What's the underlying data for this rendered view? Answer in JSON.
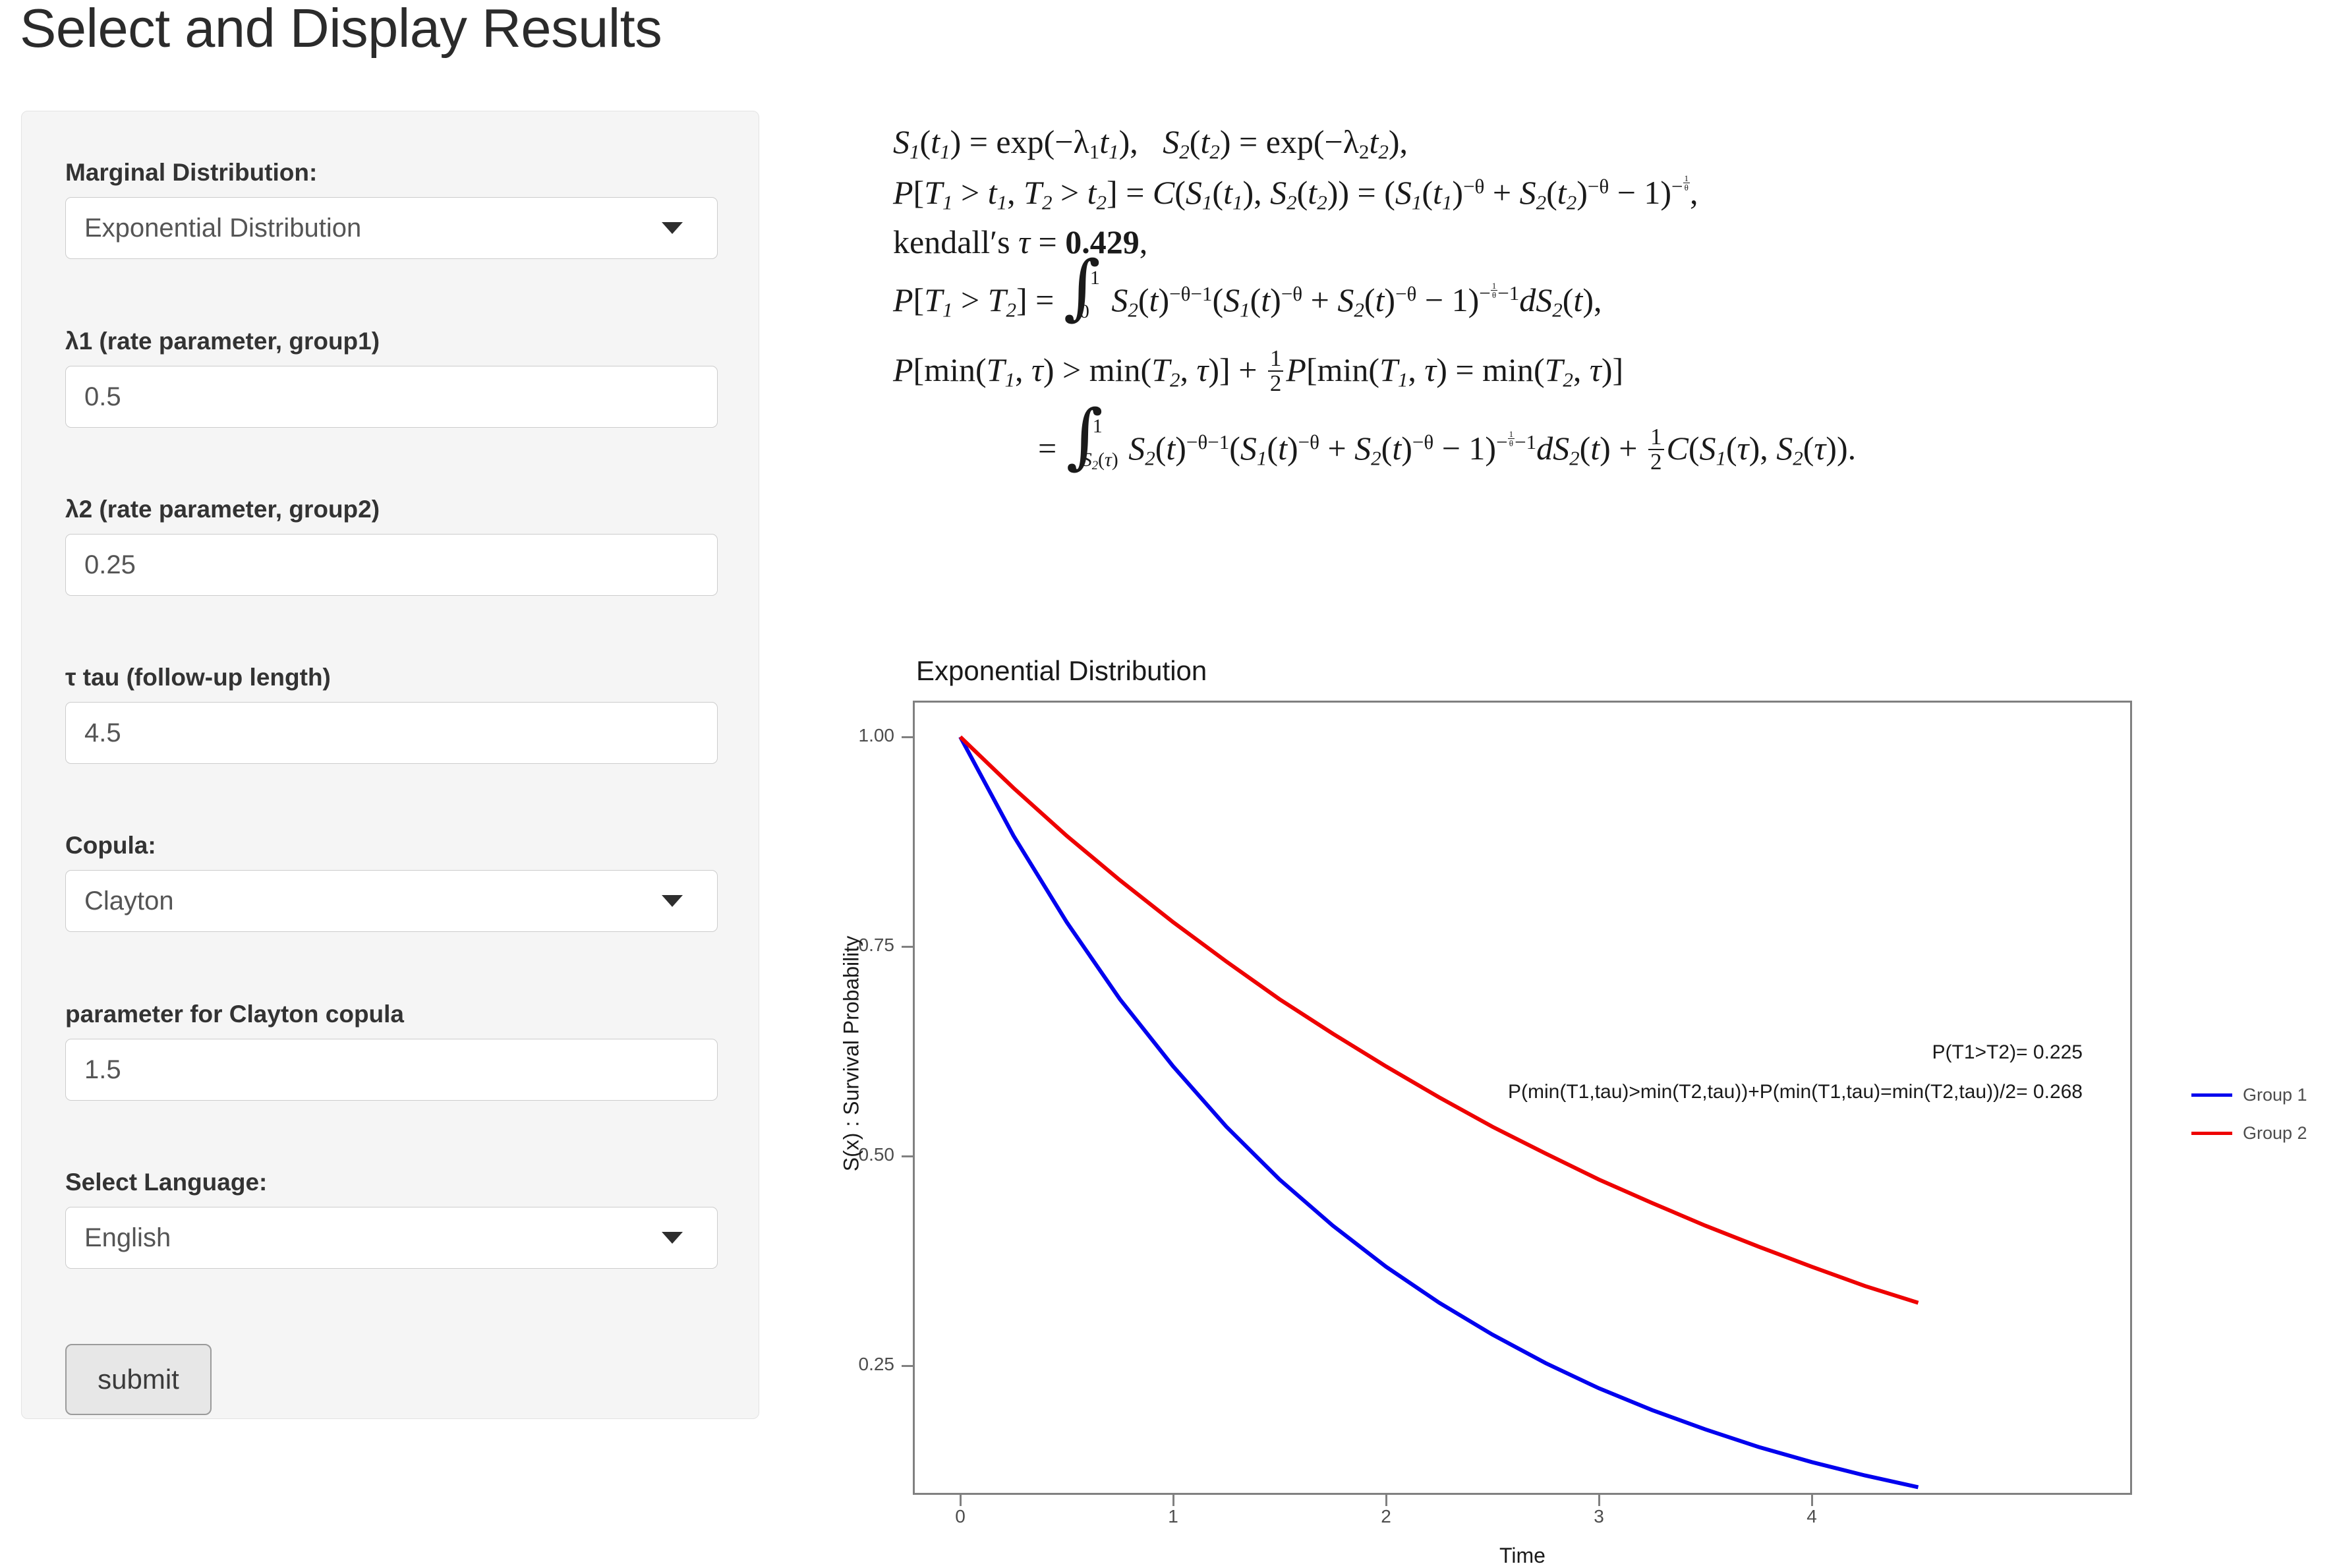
{
  "page": {
    "title": "Select and Display Results"
  },
  "form": {
    "fields": [
      {
        "label": "Marginal Distribution:",
        "type": "select",
        "value": "Exponential Distribution",
        "icon": "chevron-down-icon"
      },
      {
        "label": "λ1 (rate parameter, group1)",
        "type": "text",
        "value": "0.5"
      },
      {
        "label": "λ2 (rate parameter, group2)",
        "type": "text",
        "value": "0.25"
      },
      {
        "label": "τ tau (follow-up length)",
        "type": "text",
        "value": "4.5"
      },
      {
        "label": "Copula:",
        "type": "select",
        "value": "Clayton",
        "icon": "chevron-down-icon"
      },
      {
        "label": "parameter for Clayton copula",
        "type": "text",
        "value": "1.5"
      },
      {
        "label": "Select Language:",
        "type": "select",
        "value": "English",
        "icon": "chevron-down-icon"
      }
    ],
    "submit_label": "submit"
  },
  "formulas": {
    "kendall_tau_value": "0.429",
    "lines": [
      "S1(t1) = exp(-λ1 t1),  S2(t2) = exp(-λ2 t2),",
      "P[T1 > t1, T2 > t2] = C(S1(t1), S2(t2)) = (S1(t1)^-θ + S2(t2)^-θ - 1)^(-1/θ),",
      "kendall's τ = 0.429,",
      "P[T1 > T2] = ∫ from 0 to 1 S2(t)^(-θ-1) (S1(t)^-θ + S2(t)^-θ - 1)^(-1/θ-1) dS2(t),",
      "P[min(T1,τ) > min(T2,τ)] + 1/2 P[min(T1,τ) = min(T2,τ)]",
      "= ∫ from S2(τ) to 1 S2(t)^(-θ-1) (S1(t)^-θ + S2(t)^-θ - 1)^(-1/θ-1) dS2(t) + 1/2 C(S1(τ), S2(τ))."
    ]
  },
  "chart_data": {
    "type": "line",
    "title": "Exponential Distribution",
    "xlabel": "Time",
    "ylabel": "S(x) : Survival Probability",
    "xlim": [
      0,
      4.5
    ],
    "ylim": [
      0.105,
      1.0
    ],
    "xticks": [
      "0",
      "1",
      "2",
      "3",
      "4"
    ],
    "xtick_values": [
      0,
      1,
      2,
      3,
      4
    ],
    "yticks": [
      "1.00",
      "0.75",
      "0.50",
      "0.25"
    ],
    "ytick_values": [
      1.0,
      0.75,
      0.5,
      0.25
    ],
    "grid": false,
    "legend_position": "right",
    "series": [
      {
        "name": "Group 1",
        "color": "#0000ee",
        "rate": 0.5,
        "x": [
          0,
          0.25,
          0.5,
          0.75,
          1,
          1.25,
          1.5,
          1.75,
          2,
          2.25,
          2.5,
          2.75,
          3,
          3.25,
          3.5,
          3.75,
          4,
          4.25,
          4.5
        ],
        "y": [
          1.0,
          0.882,
          0.779,
          0.687,
          0.607,
          0.535,
          0.472,
          0.417,
          0.368,
          0.325,
          0.287,
          0.253,
          0.223,
          0.197,
          0.174,
          0.153,
          0.135,
          0.119,
          0.105
        ]
      },
      {
        "name": "Group 2",
        "color": "#ee0000",
        "rate": 0.25,
        "x": [
          0,
          0.25,
          0.5,
          0.75,
          1,
          1.25,
          1.5,
          1.75,
          2,
          2.25,
          2.5,
          2.75,
          3,
          3.25,
          3.5,
          3.75,
          4,
          4.25,
          4.5
        ],
        "y": [
          1.0,
          0.939,
          0.882,
          0.829,
          0.779,
          0.732,
          0.687,
          0.646,
          0.607,
          0.57,
          0.535,
          0.503,
          0.472,
          0.444,
          0.417,
          0.392,
          0.368,
          0.345,
          0.325
        ]
      }
    ],
    "annotations": [
      "P(T1>T2)= 0.225",
      "P(min(T1,tau)>min(T2,tau))+P(min(T1,tau)=min(T2,tau))/2= 0.268"
    ]
  },
  "colors": {
    "group1": "#0000ee",
    "group2": "#ee0000",
    "panel_bg": "#f5f5f5",
    "axis": "#808080"
  }
}
